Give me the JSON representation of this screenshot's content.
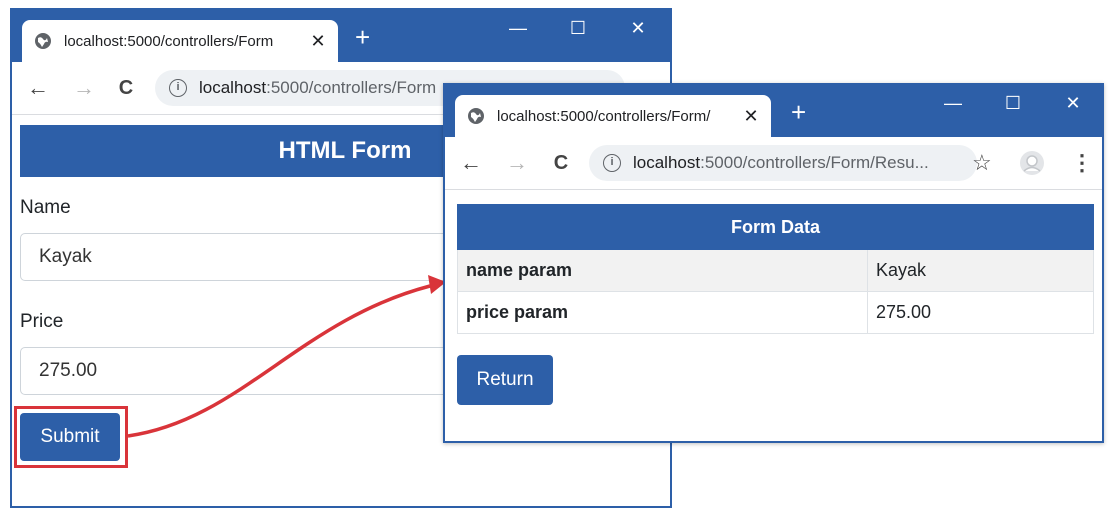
{
  "window1": {
    "tab_title": "localhost:5000/controllers/Form",
    "tab_close": "✕",
    "new_tab": "+",
    "minimize": "—",
    "maximize": "☐",
    "close": "✕",
    "back": "←",
    "forward": "→",
    "reload": "C",
    "url_host": "localhost",
    "url_path": ":5000/controllers/Form",
    "form_title": "HTML Form",
    "name_label": "Name",
    "name_value": "Kayak",
    "price_label": "Price",
    "price_value": "275.00",
    "submit_label": "Submit"
  },
  "window2": {
    "tab_title": "localhost:5000/controllers/Form/",
    "tab_close": "✕",
    "new_tab": "+",
    "minimize": "—",
    "maximize": "☐",
    "close": "✕",
    "back": "←",
    "forward": "→",
    "reload": "C",
    "url_host": "localhost",
    "url_path": ":5000/controllers/Form/Resu...",
    "star": "☆",
    "menu": "⋮",
    "table_header": "Form Data",
    "rows": [
      {
        "key": "name param",
        "value": "Kayak"
      },
      {
        "key": "price param",
        "value": "275.00"
      }
    ],
    "return_label": "Return"
  },
  "colors": {
    "accent": "#2d5fa8",
    "highlight": "#d9343a"
  }
}
